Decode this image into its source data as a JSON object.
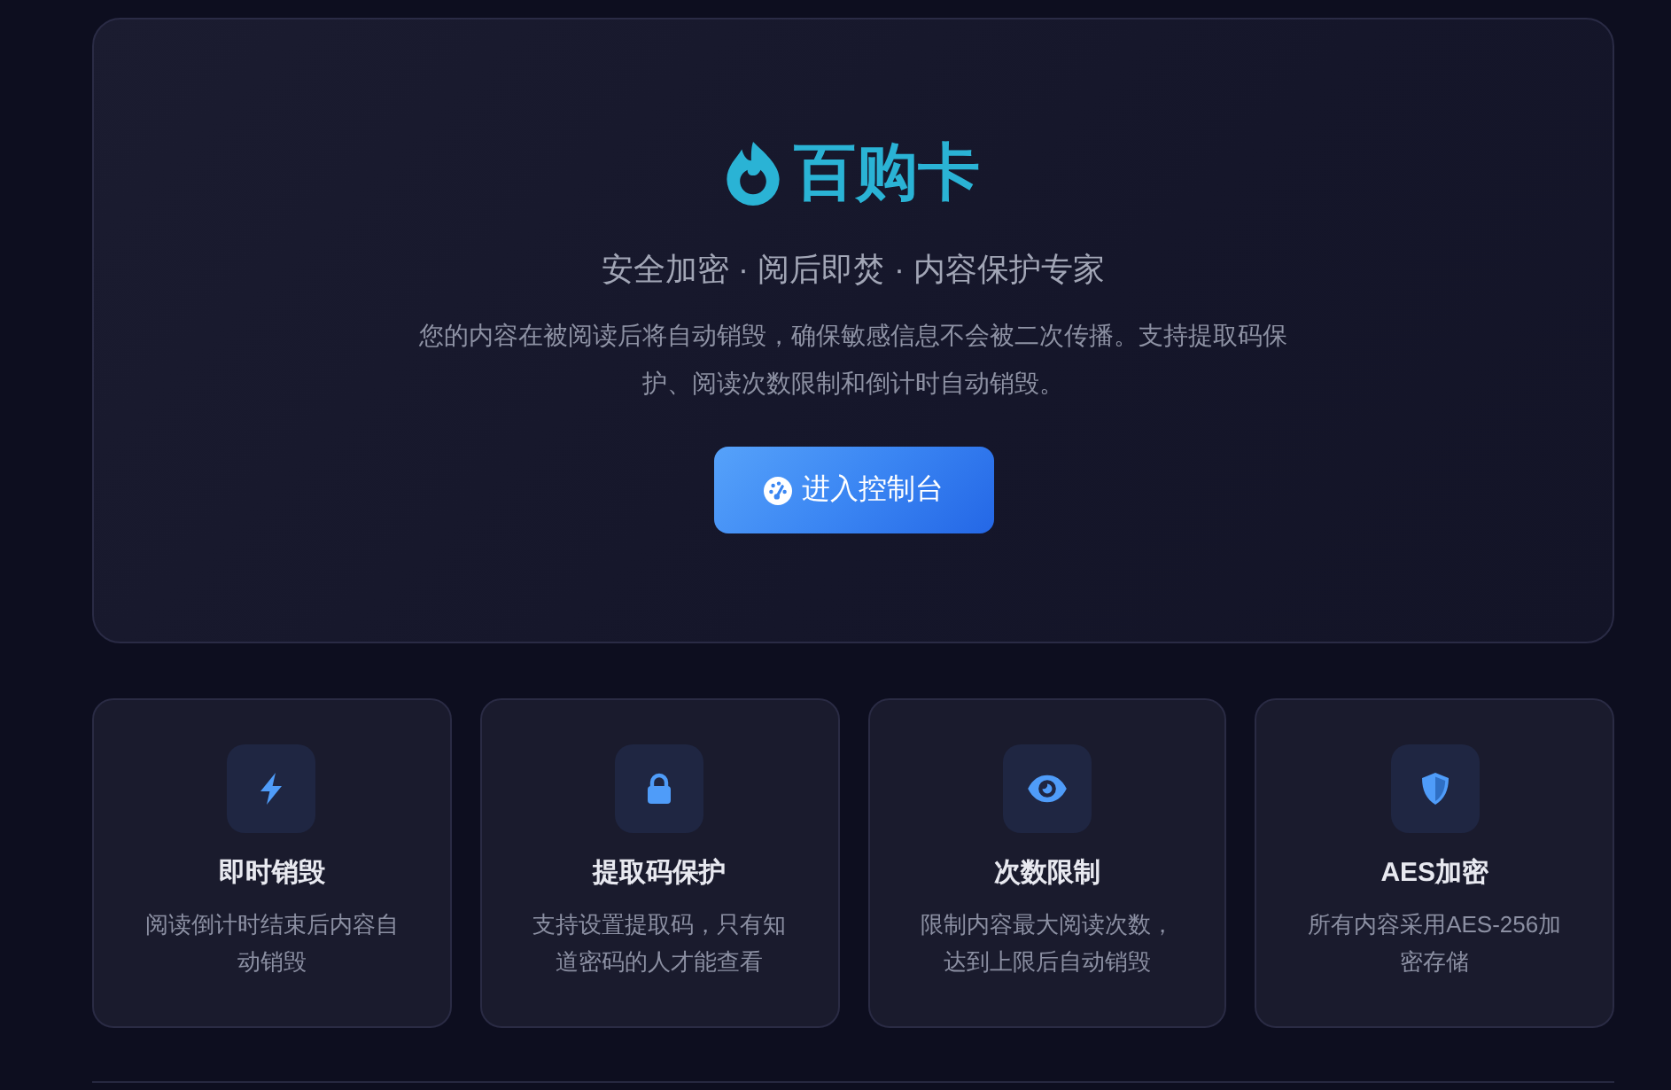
{
  "hero": {
    "brand": "百购卡",
    "tagline": "安全加密 · 阅后即焚 · 内容保护专家",
    "description": "您的内容在被阅读后将自动销毁，确保敏感信息不会被二次传播。支持提取码保护、阅读次数限制和倒计时自动销毁。",
    "button": "进入控制台"
  },
  "features": [
    {
      "title": "即时销毁",
      "description": "阅读倒计时结束后内容自动销毁"
    },
    {
      "title": "提取码保护",
      "description": "支持设置提取码，只有知道密码的人才能查看"
    },
    {
      "title": "次数限制",
      "description": "限制内容最大阅读次数，达到上限后自动销毁"
    },
    {
      "title": "AES加密",
      "description": "所有内容采用AES-256加密存储"
    }
  ]
}
